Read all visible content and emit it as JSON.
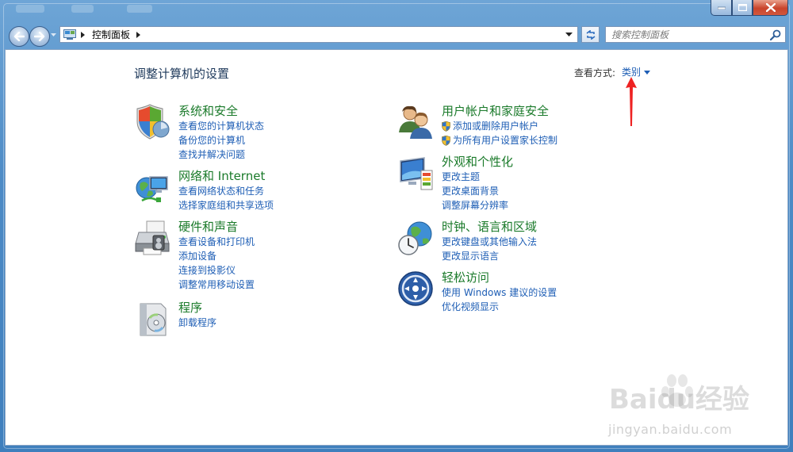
{
  "breadcrumb": {
    "item": "控制面板"
  },
  "search": {
    "placeholder": "搜索控制面板"
  },
  "header": {
    "title": "调整计算机的设置",
    "view_by_label": "查看方式:",
    "view_by_value": "类别"
  },
  "categories_left": [
    {
      "title": "系统和安全",
      "icon": "shield-icon",
      "links": [
        "查看您的计算机状态",
        "备份您的计算机",
        "查找并解决问题"
      ]
    },
    {
      "title": "网络和 Internet",
      "icon": "network-icon",
      "links": [
        "查看网络状态和任务",
        "选择家庭组和共享选项"
      ]
    },
    {
      "title": "硬件和声音",
      "icon": "printer-icon",
      "links": [
        "查看设备和打印机",
        "添加设备",
        "连接到投影仪",
        "调整常用移动设置"
      ]
    },
    {
      "title": "程序",
      "icon": "programs-icon",
      "links": [
        "卸载程序"
      ]
    }
  ],
  "categories_right": [
    {
      "title": "用户帐户和家庭安全",
      "icon": "users-icon",
      "links": [
        "添加或删除用户帐户",
        "为所有用户设置家长控制"
      ]
    },
    {
      "title": "外观和个性化",
      "icon": "appearance-icon",
      "links": [
        "更改主题",
        "更改桌面背景",
        "调整屏幕分辨率"
      ]
    },
    {
      "title": "时钟、语言和区域",
      "icon": "clock-globe-icon",
      "links": [
        "更改键盘或其他输入法",
        "更改显示语言"
      ]
    },
    {
      "title": "轻松访问",
      "icon": "ease-of-access-icon",
      "links": [
        "使用 Windows 建议的设置",
        "优化视频显示"
      ]
    }
  ],
  "watermark": {
    "brand": "Baidu经验",
    "url": "jingyan.baidu.com"
  },
  "colors": {
    "link": "#1e5eb5",
    "category_title": "#1a7a2a",
    "title": "#1e395b",
    "annotation_arrow": "#ee2222"
  }
}
